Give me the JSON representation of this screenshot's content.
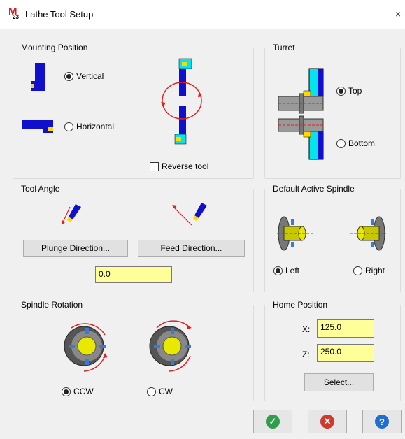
{
  "window": {
    "title": "Lathe Tool Setup",
    "icon_text": "23",
    "close_glyph": "×"
  },
  "mounting": {
    "title": "Mounting Position",
    "vertical_label": "Vertical",
    "horizontal_label": "Horizontal",
    "selected": "Vertical",
    "reverse_label": "Reverse tool",
    "reverse_checked": false
  },
  "turret": {
    "title": "Turret",
    "top_label": "Top",
    "bottom_label": "Bottom",
    "selected": "Top"
  },
  "tool_angle": {
    "title": "Tool Angle",
    "plunge_label": "Plunge Direction...",
    "feed_label": "Feed Direction...",
    "value": "0.0"
  },
  "spindle": {
    "title": "Default Active Spindle",
    "left_label": "Left",
    "right_label": "Right",
    "selected": "Left"
  },
  "rotation": {
    "title": "Spindle Rotation",
    "ccw_label": "CCW",
    "cw_label": "CW",
    "selected": "CCW"
  },
  "home": {
    "title": "Home Position",
    "x_label": "X:",
    "x_value": "125.0",
    "z_label": "Z:",
    "z_value": "250.0",
    "select_label": "Select..."
  },
  "footer": {
    "ok_icon": "check-icon",
    "cancel_icon": "cancel-icon",
    "help_icon": "help-icon"
  },
  "colors": {
    "field_bg": "#ffff99",
    "tool_blue": "#1010cc",
    "turret_cyan": "#00e5ee",
    "ok_green": "#2e9e4a",
    "cancel_red": "#d0392b",
    "help_blue": "#1e6fd0"
  }
}
